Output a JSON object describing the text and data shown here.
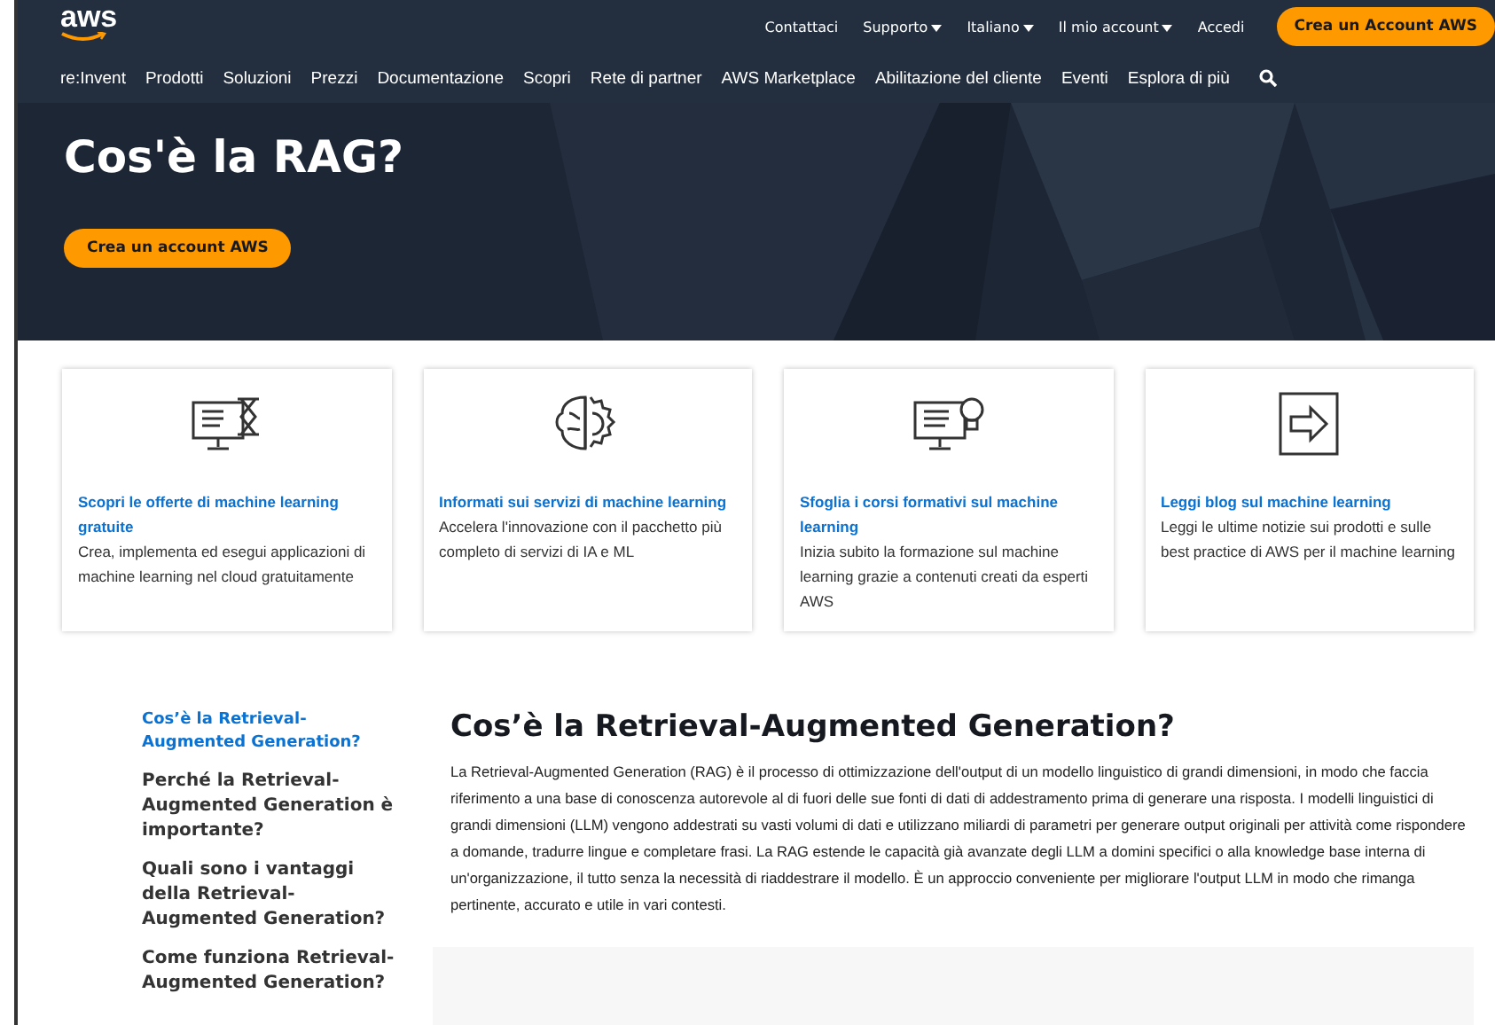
{
  "header": {
    "logo": "aws",
    "utility_links": [
      {
        "label": "Contattaci",
        "dropdown": false
      },
      {
        "label": "Supporto",
        "dropdown": true
      },
      {
        "label": "Italiano",
        "dropdown": true
      },
      {
        "label": "Il mio account",
        "dropdown": true
      },
      {
        "label": "Accedi",
        "dropdown": false
      }
    ],
    "cta": "Crea un Account AWS",
    "nav": [
      "re:Invent",
      "Prodotti",
      "Soluzioni",
      "Prezzi",
      "Documentazione",
      "Scopri",
      "Rete di partner",
      "AWS Marketplace",
      "Abilitazione del cliente",
      "Eventi",
      "Esplora di più"
    ]
  },
  "hero": {
    "title": "Cos'è la RAG?",
    "button": "Crea un account AWS"
  },
  "cards": [
    {
      "kind": "hourglass",
      "title": "Scopri le offerte di machine learning gratuite",
      "text": "Crea, implementa ed esegui applicazioni di machine learning nel cloud gratuitamente"
    },
    {
      "kind": "brain",
      "title": "Informati sui servizi di machine learning",
      "text": "Accelera l'innovazione con il pacchetto più completo di servizi di IA e ML"
    },
    {
      "kind": "lightbulb",
      "title": "Sfoglia i corsi formativi sul machine learning",
      "text": "Inizia subito la formazione sul machine learning grazie a contenuti creati da esperti AWS"
    },
    {
      "kind": "arrow",
      "title": "Leggi blog sul machine learning",
      "text": "Leggi le ultime notizie sui prodotti e sulle best practice di AWS per il machine learning"
    }
  ],
  "toc": [
    {
      "label": "Cos’è la Retrieval-Augmented Generation?",
      "selected": true
    },
    {
      "label": "Perché la Retrieval-Augmented Generation è importante?",
      "selected": false
    },
    {
      "label": "Quali sono i vantaggi della Retrieval-Augmented Generation?",
      "selected": false
    },
    {
      "label": "Come funziona Retrieval-Augmented Generation?",
      "selected": false
    }
  ],
  "article": {
    "heading": "Cos’è la Retrieval-Augmented Generation?",
    "paragraph": "La Retrieval-Augmented Generation (RAG) è il processo di ottimizzazione dell'output di un modello linguistico di grandi dimensioni, in modo che faccia riferimento a una base di conoscenza autorevole al di fuori delle sue fonti di dati di addestramento prima di generare una risposta. I modelli linguistici di grandi dimensioni (LLM) vengono addestrati su vasti volumi di dati e utilizzano miliardi di parametri per generare output originali per attività come rispondere a domande, tradurre lingue e completare frasi. La RAG estende le capacità già avanzate degli LLM a domini specifici o alla knowledge base interna di un'organizzazione, il tutto senza la necessità di riaddestrare il modello. È un approccio conveniente per migliorare l'output LLM in modo che rimanga pertinente, accurato e utile in vari contesti."
  }
}
